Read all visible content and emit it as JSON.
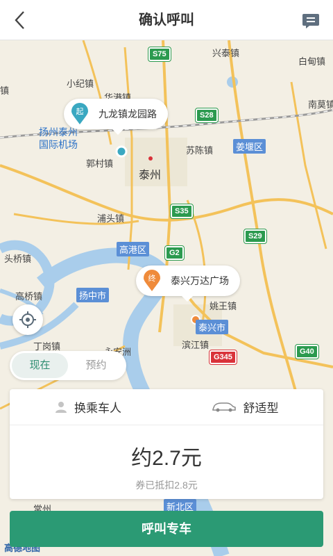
{
  "header": {
    "title": "确认呼叫",
    "back_icon": "back-arrow-icon",
    "message_icon": "message-icon"
  },
  "map": {
    "start_badge": "起",
    "start_label": "九龙镇龙园路",
    "end_badge": "终",
    "end_label": "泰兴万达广场",
    "places": {
      "xiaoji": "小纪镇",
      "huaduo": "华港镇",
      "yangzhoutaizhou": "扬州泰州",
      "airport": "国际机场",
      "guocun": "郭村镇",
      "taizhou": "泰州",
      "suchen": "苏陈镇",
      "xingtai": "兴泰镇",
      "baidian": "白甸镇",
      "nanmo": "南莫镇",
      "putou": "浦头镇",
      "touqiao": "头桥镇",
      "gaoqiao": "高桥镇",
      "yaowang": "姚王镇",
      "binjiang": "滨江镇",
      "dinggou": "丁岗镇",
      "yonganzhou": "永安洲",
      "changzhou": "常州",
      "zhen": "镇"
    },
    "zones": {
      "jiangyan": "姜堰区",
      "gaogang": "高港区",
      "yangzhong": "扬中市",
      "taixing": "泰兴市",
      "xinbei": "新北区"
    },
    "roads": {
      "s75": "S75",
      "s28": "S28",
      "s35": "S35",
      "s29": "S29",
      "g2": "G2",
      "g40": "G40",
      "g345": "G345"
    },
    "logo": "高德地图"
  },
  "time_toggle": {
    "now": "现在",
    "reserve": "预约"
  },
  "options": {
    "passenger": "换乘车人",
    "car_type": "舒适型"
  },
  "price": {
    "amount": "约2.7元",
    "discount": "券已抵扣2.8元"
  },
  "call_button": "呼叫专车",
  "colors": {
    "accent": "#2b9a74",
    "start_pin": "#3aa8c1",
    "end_pin": "#ef8b3b"
  }
}
